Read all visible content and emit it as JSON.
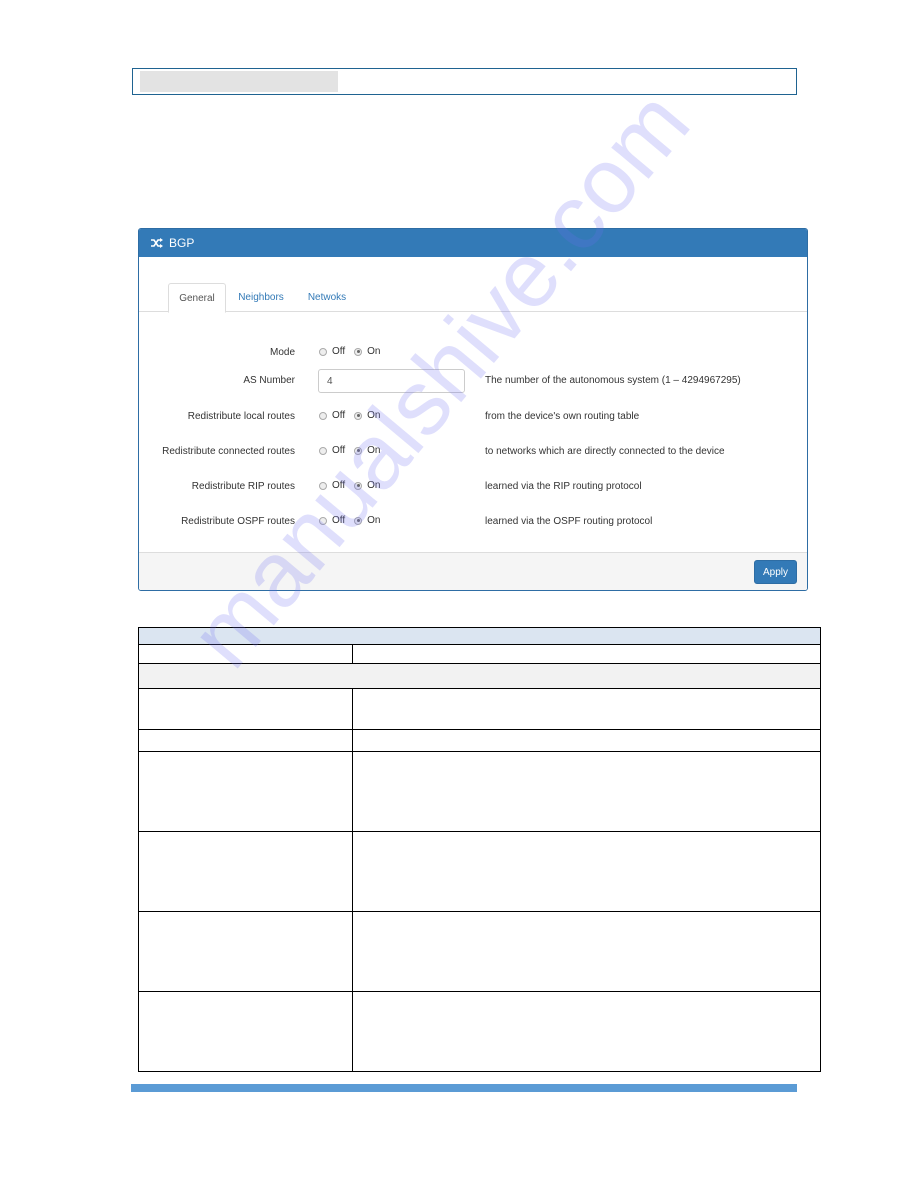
{
  "header_box": {
    "text": ""
  },
  "panel": {
    "title": "BGP",
    "title_icon": "shuffle-icon",
    "tabs": [
      {
        "label": "General",
        "active": true
      },
      {
        "label": "Neighbors",
        "active": false
      },
      {
        "label": "Netwoks",
        "active": false
      }
    ],
    "radio_options": {
      "off": "Off",
      "on": "On"
    },
    "fields": [
      {
        "label": "Mode",
        "type": "radio",
        "value": "On",
        "help": ""
      },
      {
        "label": "AS Number",
        "type": "text",
        "value": "4",
        "help": "The number of the autonomous system (1 – 4294967295)"
      },
      {
        "label": "Redistribute local routes",
        "type": "radio",
        "value": "On",
        "help": "from the device's own routing table"
      },
      {
        "label": "Redistribute connected routes",
        "type": "radio",
        "value": "On",
        "help": "to networks which are directly connected to the device"
      },
      {
        "label": "Redistribute RIP routes",
        "type": "radio",
        "value": "On",
        "help": "learned via the RIP routing protocol"
      },
      {
        "label": "Redistribute OSPF routes",
        "type": "radio",
        "value": "On",
        "help": "learned via the OSPF routing protocol"
      }
    ],
    "apply_label": "Apply"
  },
  "table": {
    "title": "",
    "header": [
      "",
      ""
    ],
    "section": "",
    "rows": [
      [
        "",
        ""
      ],
      [
        "",
        ""
      ],
      [
        "",
        ""
      ],
      [
        "",
        ""
      ],
      [
        "",
        ""
      ],
      [
        "",
        ""
      ]
    ]
  },
  "watermark": "manualshive.com",
  "colors": {
    "panel_primary": "#337ab7",
    "table_title_bg": "#dbe5f1",
    "footer_bar": "#5b9bd5"
  }
}
